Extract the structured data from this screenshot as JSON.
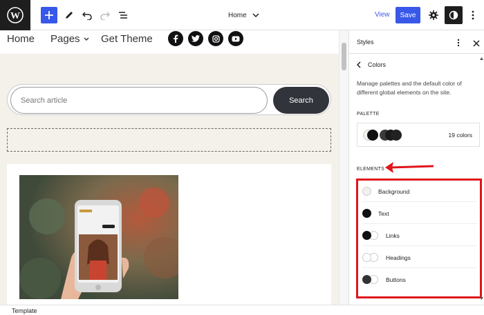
{
  "toolbar": {
    "document_title": "Home",
    "view_label": "View",
    "save_label": "Save"
  },
  "site": {
    "nav": [
      {
        "label": "Home"
      },
      {
        "label": "Pages"
      },
      {
        "label": "Get Theme"
      }
    ],
    "social": [
      "facebook-icon",
      "twitter-icon",
      "instagram-icon",
      "youtube-icon"
    ],
    "search": {
      "placeholder": "Search article",
      "button_label": "Search"
    }
  },
  "sidebar": {
    "title": "Styles",
    "back_label": "Colors",
    "description": "Manage palettes and the default color of different global elements on the site.",
    "palette_label": "PALETTE",
    "palette_count": "19 colors",
    "elements_label": "ELEMENTS",
    "elements": [
      {
        "label": "Background"
      },
      {
        "label": "Text"
      },
      {
        "label": "Links"
      },
      {
        "label": "Headings"
      },
      {
        "label": "Buttons"
      }
    ]
  },
  "footer": {
    "label": "Template"
  },
  "colors": {
    "accent": "#3858e9",
    "highlight": "#e0141b",
    "canvas_bg": "#f3f1ea",
    "dark": "#1e1e1e"
  }
}
